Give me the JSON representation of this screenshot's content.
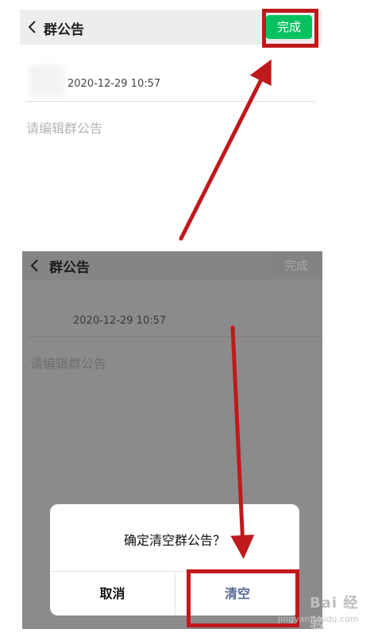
{
  "top": {
    "title": "群公告",
    "done_label": "完成",
    "timestamp": "2020-12-29 10:57",
    "placeholder": "请编辑群公告",
    "done_color": "#07c160"
  },
  "bottom": {
    "title": "群公告",
    "done_label": "完成",
    "timestamp": "2020-12-29 10:57",
    "placeholder": "请编辑群公告"
  },
  "dialog": {
    "message": "确定清空群公告？",
    "cancel_label": "取消",
    "confirm_label": "清空",
    "confirm_color": "#576b95"
  },
  "annotation": {
    "highlight_color": "#c0191b",
    "icons": [
      "back-icon",
      "arrow-icon"
    ]
  },
  "watermark": {
    "text": "Bai 经验",
    "sub": "jingyan.baidu.com"
  }
}
